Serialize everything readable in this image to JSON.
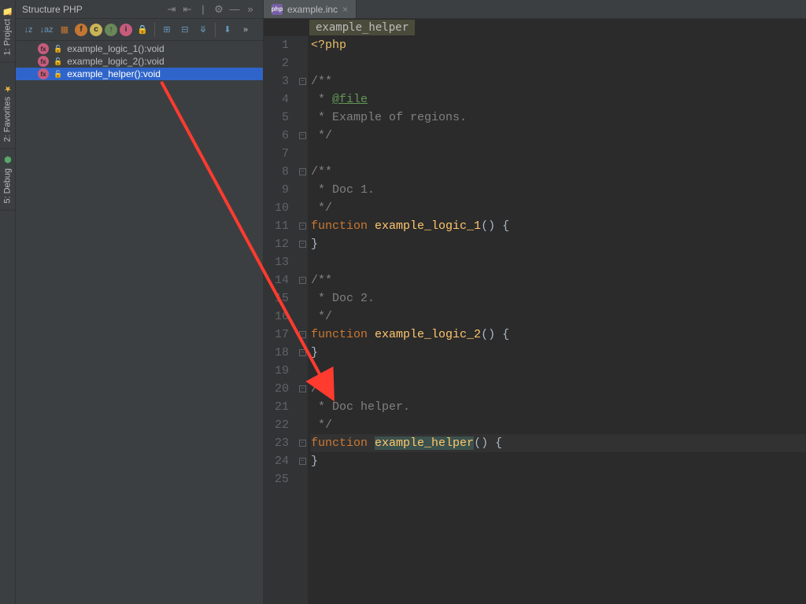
{
  "rail": {
    "project": "1: Project",
    "favorites": "2: Favorites",
    "debug": "5: Debug"
  },
  "structure": {
    "title": "Structure PHP",
    "items": [
      {
        "label": "example_logic_1():void"
      },
      {
        "label": "example_logic_2():void"
      },
      {
        "label": "example_helper():void"
      }
    ]
  },
  "tab": {
    "label": "example.inc",
    "icon_text": "php"
  },
  "breadcrumb": {
    "item": "example_helper"
  },
  "code": {
    "lines": 25,
    "content": {
      "l1": "<?php",
      "l3": "/**",
      "l4a": " * ",
      "l4b": "@file",
      "l5": " * Example of regions.",
      "l6": " */",
      "l8": "/**",
      "l9": " * Doc 1.",
      "l10": " */",
      "l11_kw": "function",
      "l11_name": "example_logic_1",
      "l11_rest": "() {",
      "l12": "}",
      "l14": "/**",
      "l15": " * Doc 2.",
      "l16": " */",
      "l17_kw": "function",
      "l17_name": "example_logic_2",
      "l17_rest": "() {",
      "l18": "}",
      "l20": "/**",
      "l21": " * Doc helper.",
      "l22": " */",
      "l23_kw": "function",
      "l23_name": "example_helper",
      "l23_rest": "() {",
      "l24": "}"
    }
  }
}
